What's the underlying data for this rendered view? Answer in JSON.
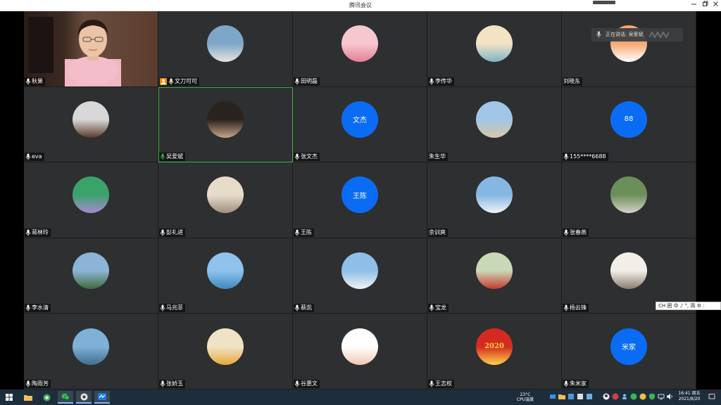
{
  "window": {
    "title": "腾讯会议"
  },
  "banner": {
    "text": "正在讲话: 吴爱斌"
  },
  "participants": [
    {
      "name": "秋果",
      "mic": true,
      "avatar_type": "video"
    },
    {
      "name": "文刀可可",
      "mic": true,
      "host": true,
      "avatar_type": "image",
      "avatar_colors": [
        "#7ea6c8",
        "#e8e4dd"
      ]
    },
    {
      "name": "田明磊",
      "mic": true,
      "avatar_type": "image",
      "avatar_colors": [
        "#f6c7cf",
        "#e47f94"
      ]
    },
    {
      "name": "李传华",
      "mic": true,
      "avatar_type": "image",
      "avatar_colors": [
        "#f3e3c3",
        "#7ab5c9"
      ]
    },
    {
      "name": "刘晓东",
      "mic": false,
      "avatar_type": "image",
      "avatar_colors": [
        "#f5a972",
        "#ffffff"
      ]
    },
    {
      "name": "eva",
      "mic": true,
      "avatar_type": "image",
      "avatar_colors": [
        "#d8d8d8",
        "#5a3a2a"
      ]
    },
    {
      "name": "吴爱斌",
      "mic": true,
      "speaking": true,
      "avatar_type": "image",
      "avatar_colors": [
        "#2a221e",
        "#c8a58a"
      ]
    },
    {
      "name": "张文杰",
      "mic": true,
      "avatar_type": "text",
      "avatar_text": "文杰"
    },
    {
      "name": "朱生华",
      "mic": false,
      "avatar_type": "image",
      "avatar_colors": [
        "#9fc6e6",
        "#d8c7a6"
      ]
    },
    {
      "name": "155****6688",
      "mic": true,
      "avatar_type": "text",
      "avatar_text": "88"
    },
    {
      "name": "蒋林玲",
      "mic": true,
      "avatar_type": "image",
      "avatar_colors": [
        "#3aa36a",
        "#a58ad2"
      ]
    },
    {
      "name": "彭礼进",
      "mic": true,
      "avatar_type": "image",
      "avatar_colors": [
        "#e7dccb",
        "#a08f7c"
      ]
    },
    {
      "name": "王陈",
      "mic": true,
      "avatar_type": "text",
      "avatar_text": "王陈"
    },
    {
      "name": "余训爽",
      "mic": false,
      "avatar_type": "image",
      "avatar_colors": [
        "#86b7e3",
        "#f0f3f6"
      ]
    },
    {
      "name": "张春燕",
      "mic": true,
      "avatar_type": "image",
      "avatar_colors": [
        "#6b8f5a",
        "#d7d2c5"
      ]
    },
    {
      "name": "李水清",
      "mic": true,
      "avatar_type": "image",
      "avatar_colors": [
        "#8cb4d6",
        "#3d6b3a"
      ]
    },
    {
      "name": "马兆菲",
      "mic": true,
      "avatar_type": "image",
      "avatar_colors": [
        "#8fc2ec",
        "#3b8ac0"
      ]
    },
    {
      "name": "蔡凯",
      "mic": true,
      "avatar_type": "image",
      "avatar_colors": [
        "#8fbfe8",
        "#f2f2f2"
      ]
    },
    {
      "name": "宝龙",
      "mic": true,
      "avatar_type": "image",
      "avatar_colors": [
        "#c9d8b6",
        "#c73a2e"
      ]
    },
    {
      "name": "杨云锋",
      "mic": true,
      "avatar_type": "image",
      "avatar_colors": [
        "#f2efe8",
        "#8a7d70"
      ]
    },
    {
      "name": "陶雨芳",
      "mic": true,
      "avatar_type": "image",
      "avatar_colors": [
        "#7fb0d6",
        "#3f6f8e"
      ]
    },
    {
      "name": "张娇玉",
      "mic": true,
      "avatar_type": "image",
      "avatar_colors": [
        "#f0e3c5",
        "#e8a83a"
      ]
    },
    {
      "name": "谷惠文",
      "mic": true,
      "avatar_type": "image",
      "avatar_colors": [
        "#ffffff",
        "#f0c9b4"
      ]
    },
    {
      "name": "王志权",
      "mic": true,
      "avatar_type": "image",
      "avatar_colors": [
        "#d42a1f",
        "#ffd24a"
      ],
      "avatar_caption": "2020"
    },
    {
      "name": "朱米家",
      "mic": true,
      "avatar_type": "text",
      "avatar_text": "米家"
    }
  ],
  "ime": {
    "text": "CH 囲 中 ♪ °, 简 ⚙ :"
  },
  "taskbar": {
    "weather_temp": "23°C",
    "weather_label": "CPU温度",
    "time": "16:41 周五",
    "date": "2021/8/20"
  },
  "colors": {
    "avatar_blue": "#0a6cf5",
    "tile_bg": "#2e2f31",
    "speaking_border": "#3ab24a",
    "host_badge": "#f08a00"
  }
}
